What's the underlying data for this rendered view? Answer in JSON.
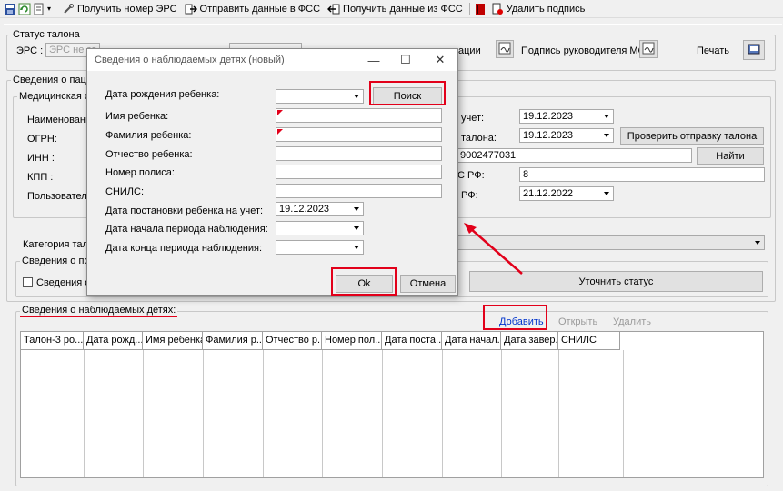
{
  "toolbar": {
    "get_erc": "Получить номер ЭРС",
    "send_fss": "Отправить данные в ФСС",
    "get_fss": "Получить данные из ФСС",
    "delete_sign": "Удалить подпись"
  },
  "status_group": {
    "legend": "Статус талона",
    "ers_label": "ЭРС :",
    "ers_value": "ЭРС не за",
    "cut_label": "ации",
    "mo_sign_label": "Подпись руководителя МО",
    "print_label": "Печать"
  },
  "patient": {
    "legend": "Сведения о пациент",
    "med_org_legend": "Медицинская орг",
    "labels": [
      "Наименование:",
      "ОГРН:",
      "ИНН :",
      "КПП :",
      "Пользователь:"
    ],
    "right_labels": [
      "учет:",
      "талона:",
      "С РФ:",
      "РФ:"
    ],
    "date_reg": "19.12.2023",
    "date_talon": "19.12.2023",
    "check_send_button": "Проверить отправку талона",
    "inn_value": "9002477031",
    "find_button": "Найти",
    "snils_rf_value": "8",
    "date_rf": "21.12.2022"
  },
  "category": {
    "label": "Категория талон",
    "post_legend": "Сведения о пост",
    "post_check_label": "Сведения о п",
    "clarify_status": "Уточнить статус"
  },
  "children": {
    "legend": "Сведения о наблюдаемых детях:",
    "add": "Добавить",
    "open": "Открыть",
    "delete": "Удалить",
    "columns": [
      "Талон-3 ро...",
      "Дата рожд...",
      "Имя ребенка",
      "Фамилия р...",
      "Отчество р...",
      "Номер пол...",
      "Дата поста...",
      "Дата начал...",
      "Дата завер...",
      "СНИЛС"
    ]
  },
  "dialog": {
    "title": "Сведения о наблюдаемых детях (новый)",
    "fields": {
      "birth_date": "Дата рождения ребенка:",
      "child_name": "Имя ребенка:",
      "child_surname": "Фамилия ребенка:",
      "child_patronymic": "Отчество ребенка:",
      "policy": "Номер полиса:",
      "snils": "СНИЛС:",
      "reg_date": "Дата постановки ребенка на учет:",
      "obs_start": "Дата начала периода наблюдения:",
      "obs_end": "Дата конца периода наблюдения:"
    },
    "reg_date_value": "19.12.2023",
    "search_button": "Поиск",
    "ok_button": "Ok",
    "cancel_button": "Отмена"
  },
  "colors": {
    "highlight": "#e2001a",
    "link": "#0033cc"
  }
}
